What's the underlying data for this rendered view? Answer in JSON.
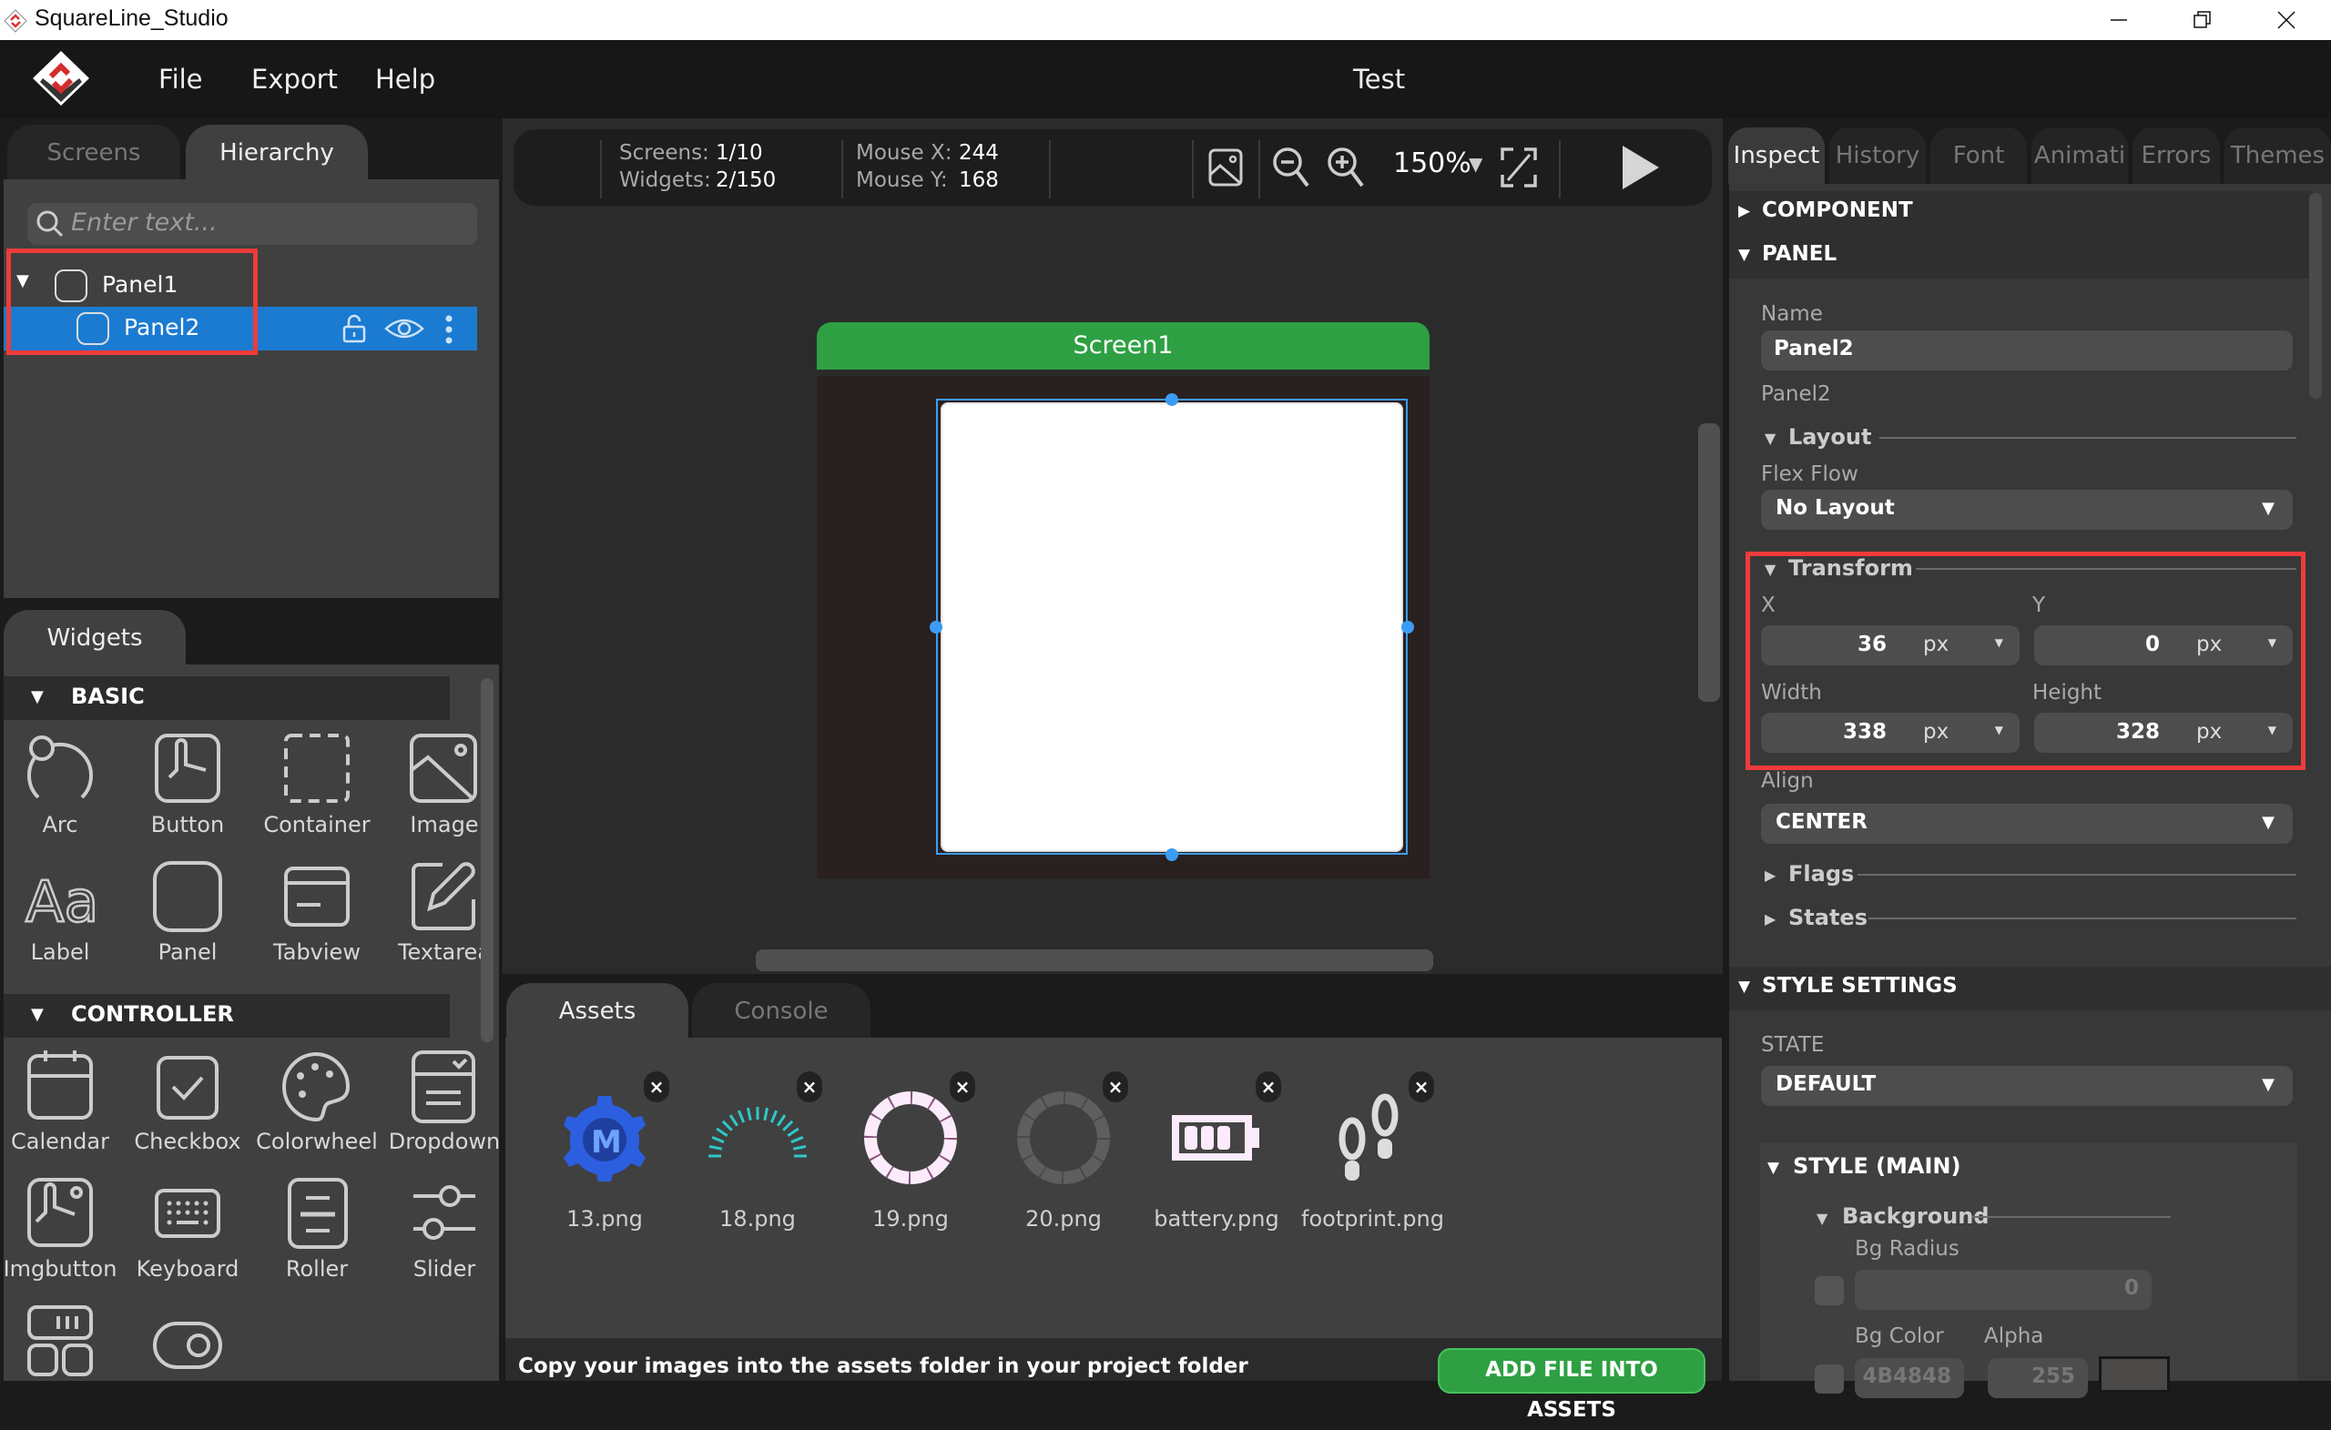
{
  "window": {
    "title": "SquareLine_Studio",
    "controls": [
      "minimize",
      "restore",
      "close"
    ]
  },
  "menubar": {
    "items": [
      "File",
      "Export",
      "Help"
    ],
    "project_title": "Test"
  },
  "left_panel": {
    "tabs": [
      {
        "label": "Screens",
        "active": false
      },
      {
        "label": "Hierarchy",
        "active": true
      }
    ],
    "search_placeholder": "Enter text...",
    "tree": [
      {
        "label": "Panel1",
        "expanded": true,
        "selected": false,
        "depth": 0
      },
      {
        "label": "Panel2",
        "selected": true,
        "depth": 1
      }
    ]
  },
  "widgets_panel": {
    "tab": "Widgets",
    "categories": [
      {
        "name": "BASIC",
        "items": [
          "Arc",
          "Button",
          "Container",
          "Image",
          "Label",
          "Panel",
          "Tabview",
          "Textarea"
        ]
      },
      {
        "name": "CONTROLLER",
        "items": [
          "Calendar",
          "Checkbox",
          "Colorwheel",
          "Dropdown",
          "Imgbutton",
          "Keyboard",
          "Roller",
          "Slider",
          "",
          ""
        ]
      }
    ]
  },
  "toolbar": {
    "screens_label": "Screens:",
    "screens_value": "1/10",
    "widgets_label": "Widgets:",
    "widgets_value": "2/150",
    "mouse_x_label": "Mouse X:",
    "mouse_x_value": "244",
    "mouse_y_label": "Mouse Y:",
    "mouse_y_value": "168",
    "zoom": "150%"
  },
  "canvas": {
    "screen_name": "Screen1",
    "screen_header_color": "#2ea043",
    "selection_color": "#3c9cf3"
  },
  "assets_panel": {
    "tabs": [
      {
        "label": "Assets",
        "active": true
      },
      {
        "label": "Console",
        "active": false
      }
    ],
    "files": [
      "13.png",
      "18.png",
      "19.png",
      "20.png",
      "battery.png",
      "footprint.png"
    ],
    "hint": "Copy your images into the assets folder in your project folder",
    "add_button": "ADD FILE INTO ASSETS"
  },
  "inspector": {
    "tabs": [
      "Inspect",
      "History",
      "Font",
      "Animati",
      "Errors",
      "Themes"
    ],
    "active_tab": "Inspect",
    "sections": {
      "component": "COMPONENT",
      "panel": "PANEL",
      "style_settings": "STYLE SETTINGS"
    },
    "name_label": "Name",
    "name_value": "Panel2",
    "type_text": "Panel2",
    "layout": {
      "title": "Layout",
      "flex_flow_label": "Flex Flow",
      "flex_flow_value": "No Layout"
    },
    "transform": {
      "title": "Transform",
      "x_label": "X",
      "x_value": "36",
      "x_unit": "px",
      "y_label": "Y",
      "y_value": "0",
      "y_unit": "px",
      "width_label": "Width",
      "width_value": "338",
      "width_unit": "px",
      "height_label": "Height",
      "height_value": "328",
      "height_unit": "px"
    },
    "align_label": "Align",
    "align_value": "CENTER",
    "flags": "Flags",
    "states": "States",
    "state_label": "STATE",
    "state_value": "DEFAULT",
    "style_main": "STYLE (MAIN)",
    "background": {
      "title": "Background",
      "bg_radius_label": "Bg Radius",
      "bg_radius_value": "0",
      "bg_color_label": "Bg Color",
      "bg_color_value": "4B4848",
      "alpha_label": "Alpha",
      "alpha_value": "255",
      "swatch_color": "#4b4848"
    }
  }
}
